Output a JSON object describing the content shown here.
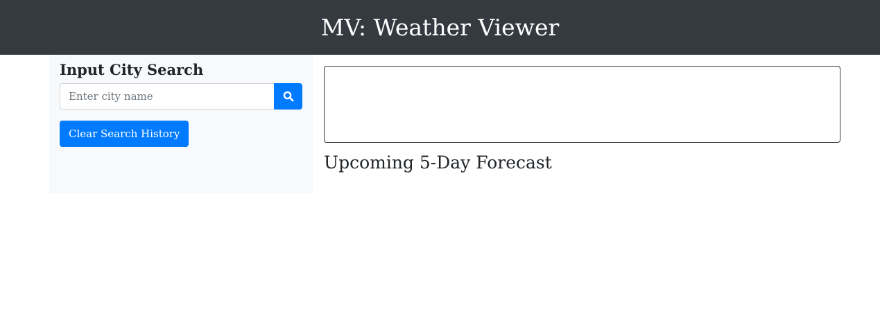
{
  "header": {
    "title": "MV: Weather Viewer"
  },
  "sidebar": {
    "heading": "Input City Search",
    "search": {
      "placeholder": "Enter city name",
      "value": "",
      "icon": "search-icon"
    },
    "clear_button_label": "Clear Search History"
  },
  "main": {
    "current_weather": "",
    "forecast_heading": "Upcoming 5-Day Forecast"
  },
  "colors": {
    "header_bg": "#343a40",
    "sidebar_bg": "#f8f9fa",
    "primary": "#007bff"
  }
}
